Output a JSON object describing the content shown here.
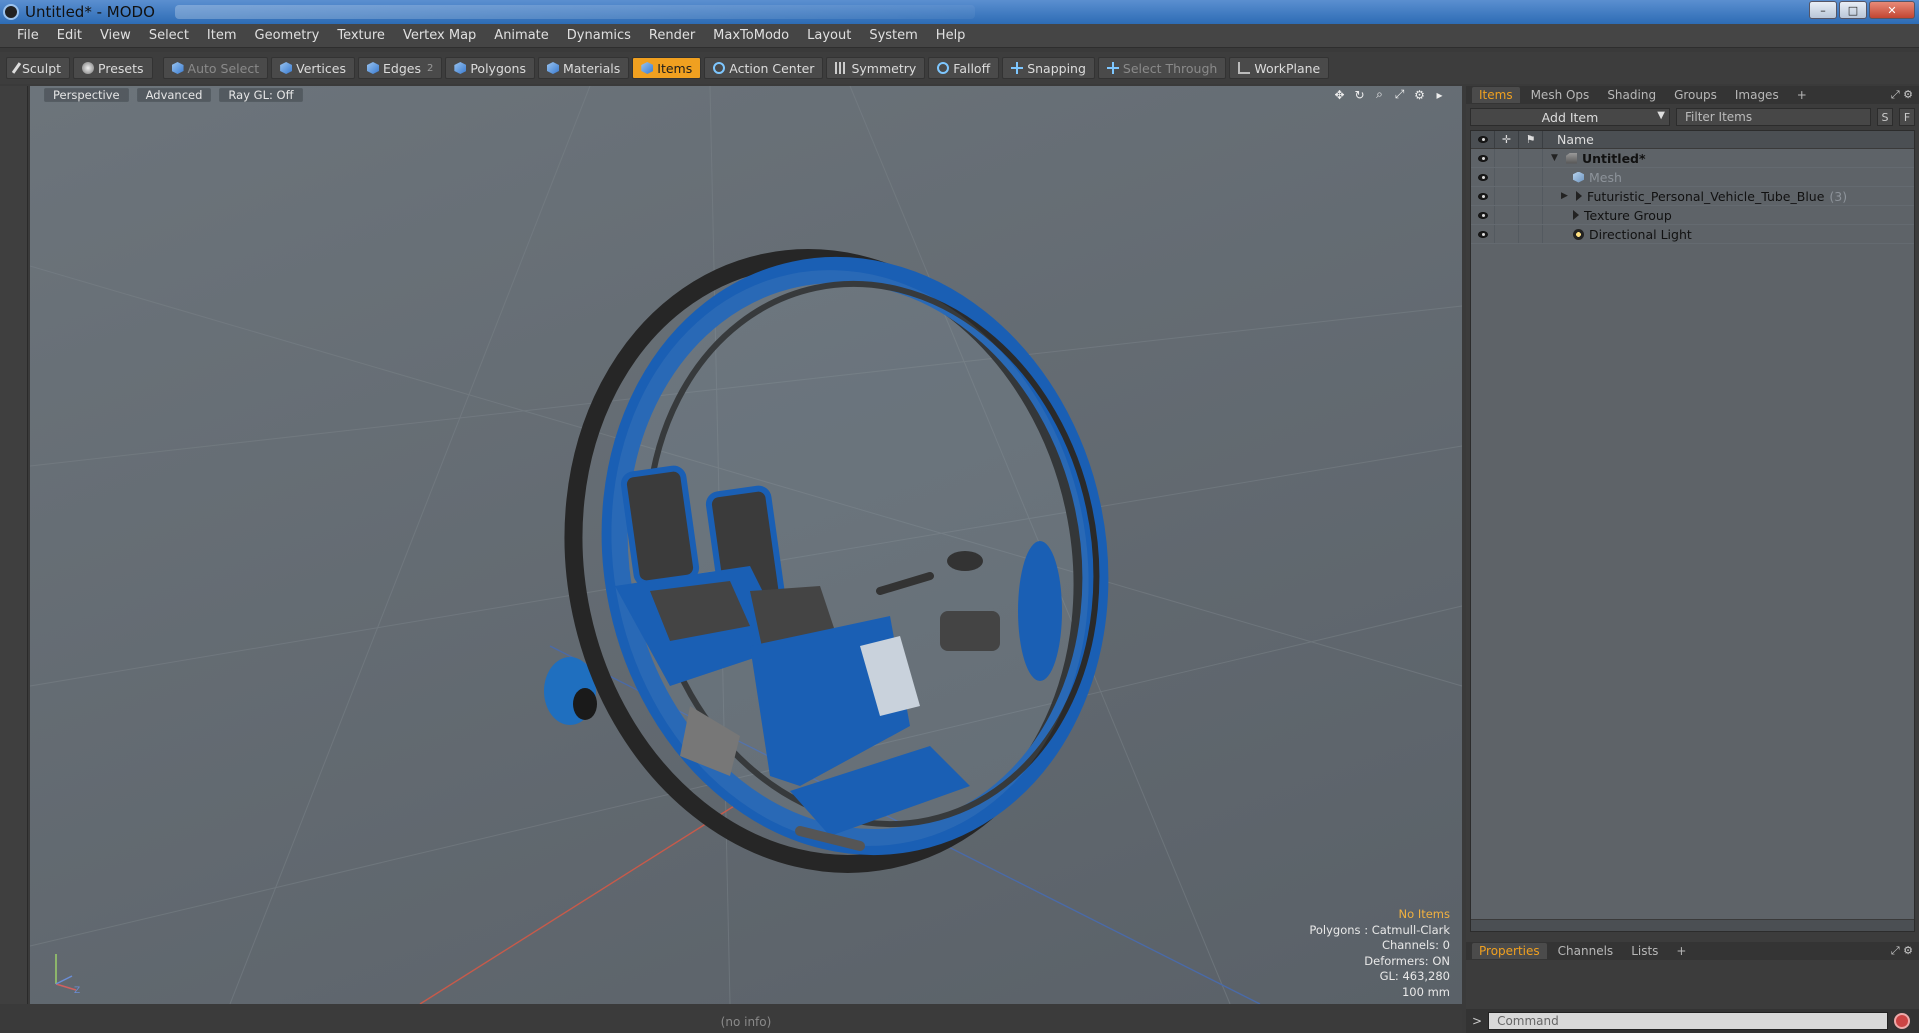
{
  "window": {
    "title": "Untitled* - MODO",
    "controls": [
      "–",
      "□",
      "✕"
    ]
  },
  "menu": [
    "File",
    "Edit",
    "View",
    "Select",
    "Item",
    "Geometry",
    "Texture",
    "Vertex Map",
    "Animate",
    "Dynamics",
    "Render",
    "MaxToModo",
    "Layout",
    "System",
    "Help"
  ],
  "toolbar": {
    "sculpt": "Sculpt",
    "presets": "Presets",
    "auto_select": "Auto Select",
    "vertices": "Vertices",
    "edges": "Edges",
    "edges_count": "2",
    "polygons": "Polygons",
    "materials": "Materials",
    "items": "Items",
    "action_center": "Action Center",
    "symmetry": "Symmetry",
    "falloff": "Falloff",
    "snapping": "Snapping",
    "select_through": "Select Through",
    "workplane": "WorkPlane"
  },
  "viewport": {
    "tabs": [
      "Perspective",
      "Advanced",
      "Ray GL: Off"
    ],
    "info": {
      "selection": "No Items",
      "polygons": "Polygons : Catmull-Clark",
      "channels": "Channels: 0",
      "deformers": "Deformers: ON",
      "gl": "GL: 463,280",
      "unit": "100 mm"
    },
    "axis_labels": [
      "Y",
      "X",
      "Z"
    ]
  },
  "status": {
    "text": "(no info)"
  },
  "items_panel": {
    "tabs": [
      "Items",
      "Mesh Ops",
      "Shading",
      "Groups",
      "Images",
      "+"
    ],
    "add_item": "Add Item",
    "filter_placeholder": "Filter Items",
    "btn_s": "S",
    "btn_f": "F",
    "column_name": "Name",
    "rows": [
      {
        "label": "Untitled*",
        "count": ""
      },
      {
        "label": "Mesh",
        "count": ""
      },
      {
        "label": "Futuristic_Personal_Vehicle_Tube_Blue",
        "count": "(3)"
      },
      {
        "label": "Texture Group",
        "count": ""
      },
      {
        "label": "Directional Light",
        "count": ""
      }
    ]
  },
  "properties_panel": {
    "tabs": [
      "Properties",
      "Channels",
      "Lists",
      "+"
    ]
  },
  "command": {
    "prompt": ">",
    "placeholder": "Command"
  },
  "colors": {
    "accent": "#f0a020",
    "vehicle_blue": "#1a5fb4",
    "viewport_bg": "#656c73"
  }
}
